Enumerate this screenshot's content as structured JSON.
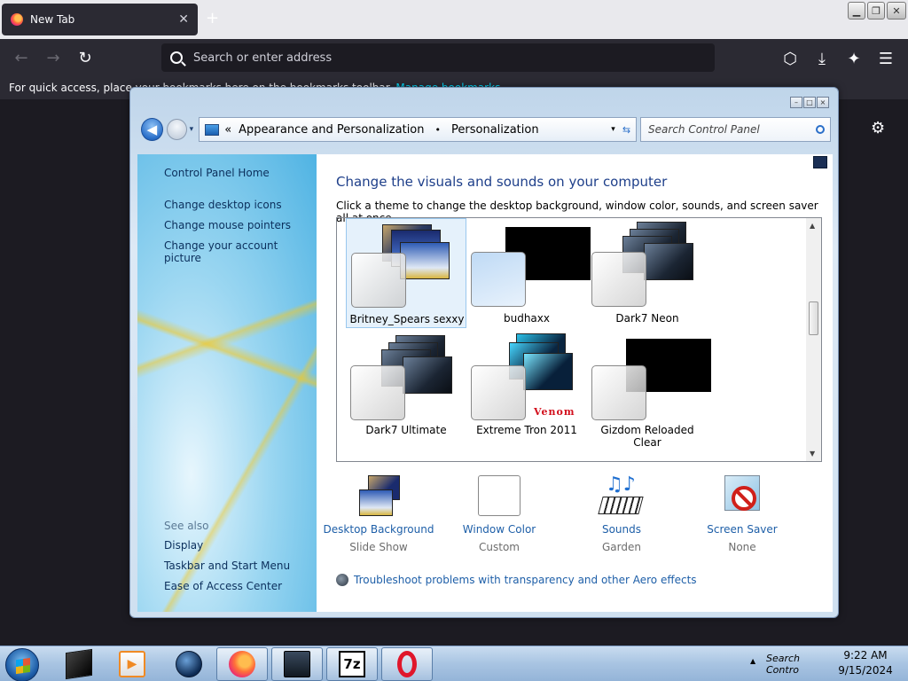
{
  "browser": {
    "tab_title": "New Tab",
    "tab_close": "✕",
    "new_tab": "+",
    "min": "▁",
    "restore": "❐",
    "close": "✕",
    "back": "←",
    "forward": "→",
    "reload": "↻",
    "url_placeholder": "Search or enter address",
    "pocket": "⬡",
    "download": "⤓",
    "extensions": "✦",
    "menu": "☰",
    "bookmarks_text": "For quick access, place your bookmarks here on the bookmarks toolbar.",
    "bookmarks_link": "Manage bookmarks",
    "settings": "⚙"
  },
  "cp": {
    "ctrl_min": "–",
    "ctrl_max": "□",
    "ctrl_close": "×",
    "back": "◀",
    "recent": "▾",
    "crumb_prefix": "«",
    "crumb_1": "Appearance and Personalization",
    "crumb_sep": "•",
    "crumb_2": "Personalization",
    "crumb_dd": "▾",
    "refresh": "⇆",
    "search_placeholder": "Search Control Panel",
    "left_links": [
      "Control Panel Home",
      "Change desktop icons",
      "Change mouse pointers",
      "Change your account picture"
    ],
    "see_also": "See also",
    "see_also_links": [
      "Display",
      "Taskbar and Start Menu",
      "Ease of Access Center"
    ],
    "heading": "Change the visuals and sounds on your computer",
    "subheading": "Click a theme to change the desktop background, window color, sounds, and screen saver all at once.",
    "themes": [
      {
        "name": "Britney_Spears sexxy",
        "selected": true
      },
      {
        "name": "budhaxx"
      },
      {
        "name": "Dark7 Neon"
      },
      {
        "name": "Dark7 Ultimate"
      },
      {
        "name": "Extreme Tron 2011"
      },
      {
        "name": "Gizdom Reloaded",
        "name2": "Clear"
      }
    ],
    "tron_logo": "Venom",
    "scroll_up": "▲",
    "scroll_down": "▼",
    "settings": [
      {
        "name": "Desktop Background",
        "value": "Slide Show"
      },
      {
        "name": "Window Color",
        "value": "Custom"
      },
      {
        "name": "Sounds",
        "value": "Garden"
      },
      {
        "name": "Screen Saver",
        "value": "None"
      }
    ],
    "troubleshoot": "Troubleshoot problems with transparency and other Aero effects"
  },
  "taskbar": {
    "tray_text": "Search Contro",
    "tray_up": "▲",
    "time": "9:22 AM",
    "date": "9/15/2024",
    "sevenzip": "7z"
  },
  "colors": {
    "link_blue": "#1e5fa8",
    "heading_blue": "#1e3f8a",
    "firefox_dark": "#2b2a33"
  }
}
